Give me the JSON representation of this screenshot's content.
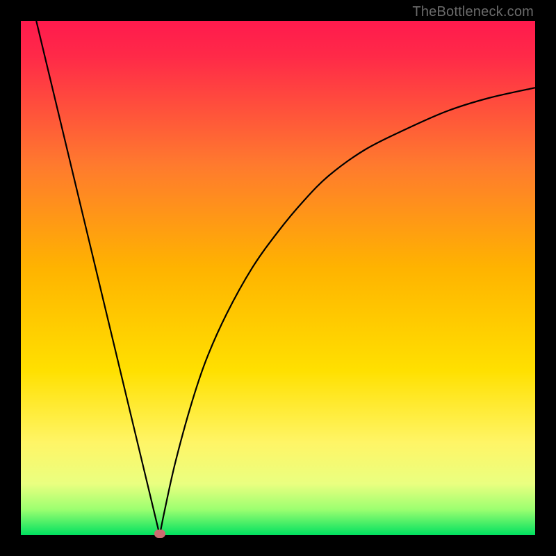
{
  "watermark": "TheBottleneck.com",
  "colors": {
    "top": "#ff1a4d",
    "upper_mid": "#ff8a2a",
    "mid": "#ffd000",
    "lower_mid": "#fff04d",
    "near_bottom": "#d8ff66",
    "bottom": "#00e060",
    "curve": "#000000",
    "marker": "#cc6b70",
    "frame": "#000000"
  },
  "chart_data": {
    "type": "line",
    "title": "",
    "xlabel": "",
    "ylabel": "",
    "xlim": [
      0,
      100
    ],
    "ylim": [
      0,
      100
    ],
    "grid": false,
    "legend": false,
    "series": [
      {
        "name": "left-branch",
        "x": [
          3,
          27
        ],
        "y": [
          100,
          0
        ]
      },
      {
        "name": "right-branch",
        "x": [
          27,
          28,
          30,
          33,
          36,
          40,
          45,
          50,
          55,
          60,
          67,
          75,
          83,
          91,
          100
        ],
        "y": [
          0,
          5,
          14,
          25,
          34,
          43,
          52,
          59,
          65,
          70,
          75,
          79,
          82.5,
          85,
          87
        ]
      }
    ],
    "annotations": [
      {
        "name": "minimum-marker",
        "x": 27,
        "y": 0
      }
    ],
    "background_gradient_stops": [
      {
        "pos": 0.0,
        "color": "#ff1a4d"
      },
      {
        "pos": 0.07,
        "color": "#ff2a48"
      },
      {
        "pos": 0.28,
        "color": "#ff7a2e"
      },
      {
        "pos": 0.48,
        "color": "#ffb300"
      },
      {
        "pos": 0.68,
        "color": "#ffe000"
      },
      {
        "pos": 0.82,
        "color": "#fff566"
      },
      {
        "pos": 0.9,
        "color": "#eaff80"
      },
      {
        "pos": 0.95,
        "color": "#9cff70"
      },
      {
        "pos": 1.0,
        "color": "#00e060"
      }
    ]
  }
}
